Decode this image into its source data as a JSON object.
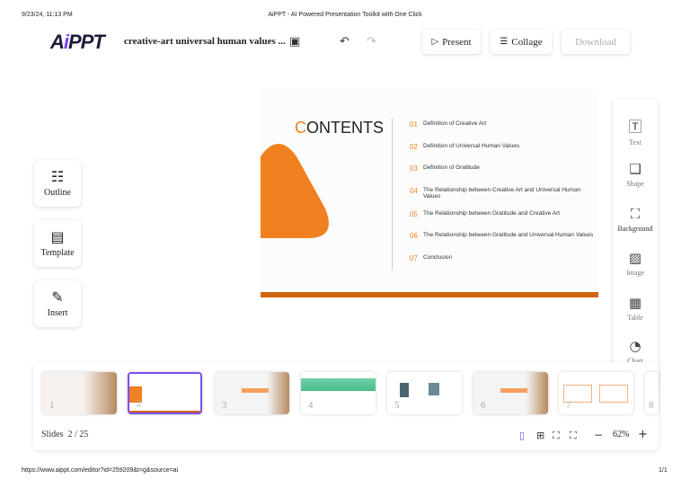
{
  "print_header": {
    "datetime": "9/23/24, 11:13 PM",
    "page_title": "AiPPT - AI Powered Presentation Toolkit with One Click"
  },
  "header": {
    "logo": "AiPPT",
    "doc_title": "creative-art universal human values ...",
    "present": "Present",
    "collage": "Collage",
    "download": "Download"
  },
  "left_panel": [
    {
      "label": "Outline",
      "icon": "outline-icon"
    },
    {
      "label": "Template",
      "icon": "template-icon"
    },
    {
      "label": "Insert",
      "icon": "insert-icon"
    }
  ],
  "right_tools": [
    {
      "label": "Text",
      "icon": "text-icon"
    },
    {
      "label": "Shape",
      "icon": "shape-icon"
    },
    {
      "label": "Background",
      "icon": "background-icon"
    },
    {
      "label": "Image",
      "icon": "image-icon"
    },
    {
      "label": "Table",
      "icon": "table-icon"
    },
    {
      "label": "Chart",
      "icon": "chart-icon"
    }
  ],
  "slide": {
    "title_first": "C",
    "title_rest": "ONTENTS",
    "accent": "#f08020",
    "items": [
      {
        "n": "01",
        "t": "Definition of Creative Art"
      },
      {
        "n": "02",
        "t": "Definition of Universal Human Values"
      },
      {
        "n": "03",
        "t": "Definition of Gratitude"
      },
      {
        "n": "04",
        "t": "The Relationship between Creative Art and Universal Human Values"
      },
      {
        "n": "05",
        "t": "The Relationship between Gratitude and Creative Art"
      },
      {
        "n": "06",
        "t": "The Relationship between Gratitude and Universal Human Values"
      },
      {
        "n": "07",
        "t": "Conclusion"
      }
    ]
  },
  "thumbnails": [
    "1",
    "2",
    "3",
    "4",
    "5",
    "6",
    "7",
    "8"
  ],
  "footer": {
    "slides_label": "Slides",
    "slides_count": "2 / 25",
    "zoom": "62%"
  },
  "print_footer": {
    "url": "https://www.aippt.com/editor?id=259209&t=g&source=ai",
    "page": "1/1"
  }
}
